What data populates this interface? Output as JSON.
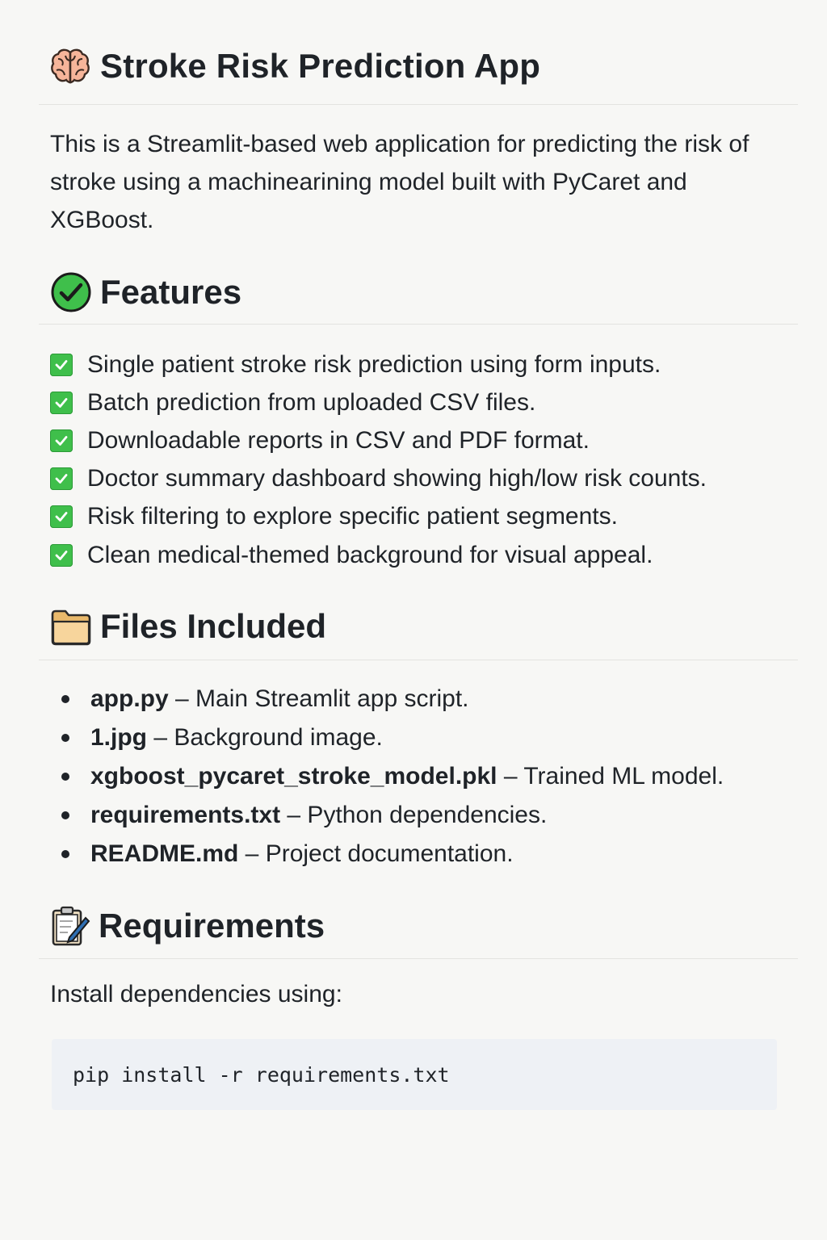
{
  "title": {
    "icon": "brain-icon",
    "text": "Stroke Risk Prediction App"
  },
  "intro": "This is a Streamlit-based web application for predicting the risk of stroke using a machinearining model built with PyCaret and XGBoost.",
  "features": {
    "icon": "check-circle-icon",
    "heading": "Features",
    "items": [
      "Single patient stroke risk prediction using form inputs.",
      "Batch prediction from uploaded CSV files.",
      "Downloadable reports in CSV and PDF format.",
      "Doctor summary dashboard showing high/low risk counts.",
      "Risk filtering to explore specific patient segments.",
      "Clean medical-themed background for visual appeal."
    ]
  },
  "files": {
    "icon": "folder-icon",
    "heading": "Files Included",
    "items": [
      {
        "name": "app.py",
        "desc": " – Main Streamlit app script."
      },
      {
        "name": "1.jpg",
        "desc": " – Background image."
      },
      {
        "name": "xgboost_pycaret_stroke_model.pkl",
        "desc": " – Trained ML model."
      },
      {
        "name": "requirements.txt",
        "desc": " – Python dependencies."
      },
      {
        "name": "README.md",
        "desc": " – Project documentation."
      }
    ]
  },
  "requirements": {
    "icon": "clipboard-icon",
    "heading": "Requirements",
    "text": "Install dependencies using:",
    "code": "pip install -r requirements.txt"
  },
  "colors": {
    "check_green": "#3fbf4b",
    "code_bg": "#eef1f5",
    "page_bg": "#f7f7f5"
  }
}
